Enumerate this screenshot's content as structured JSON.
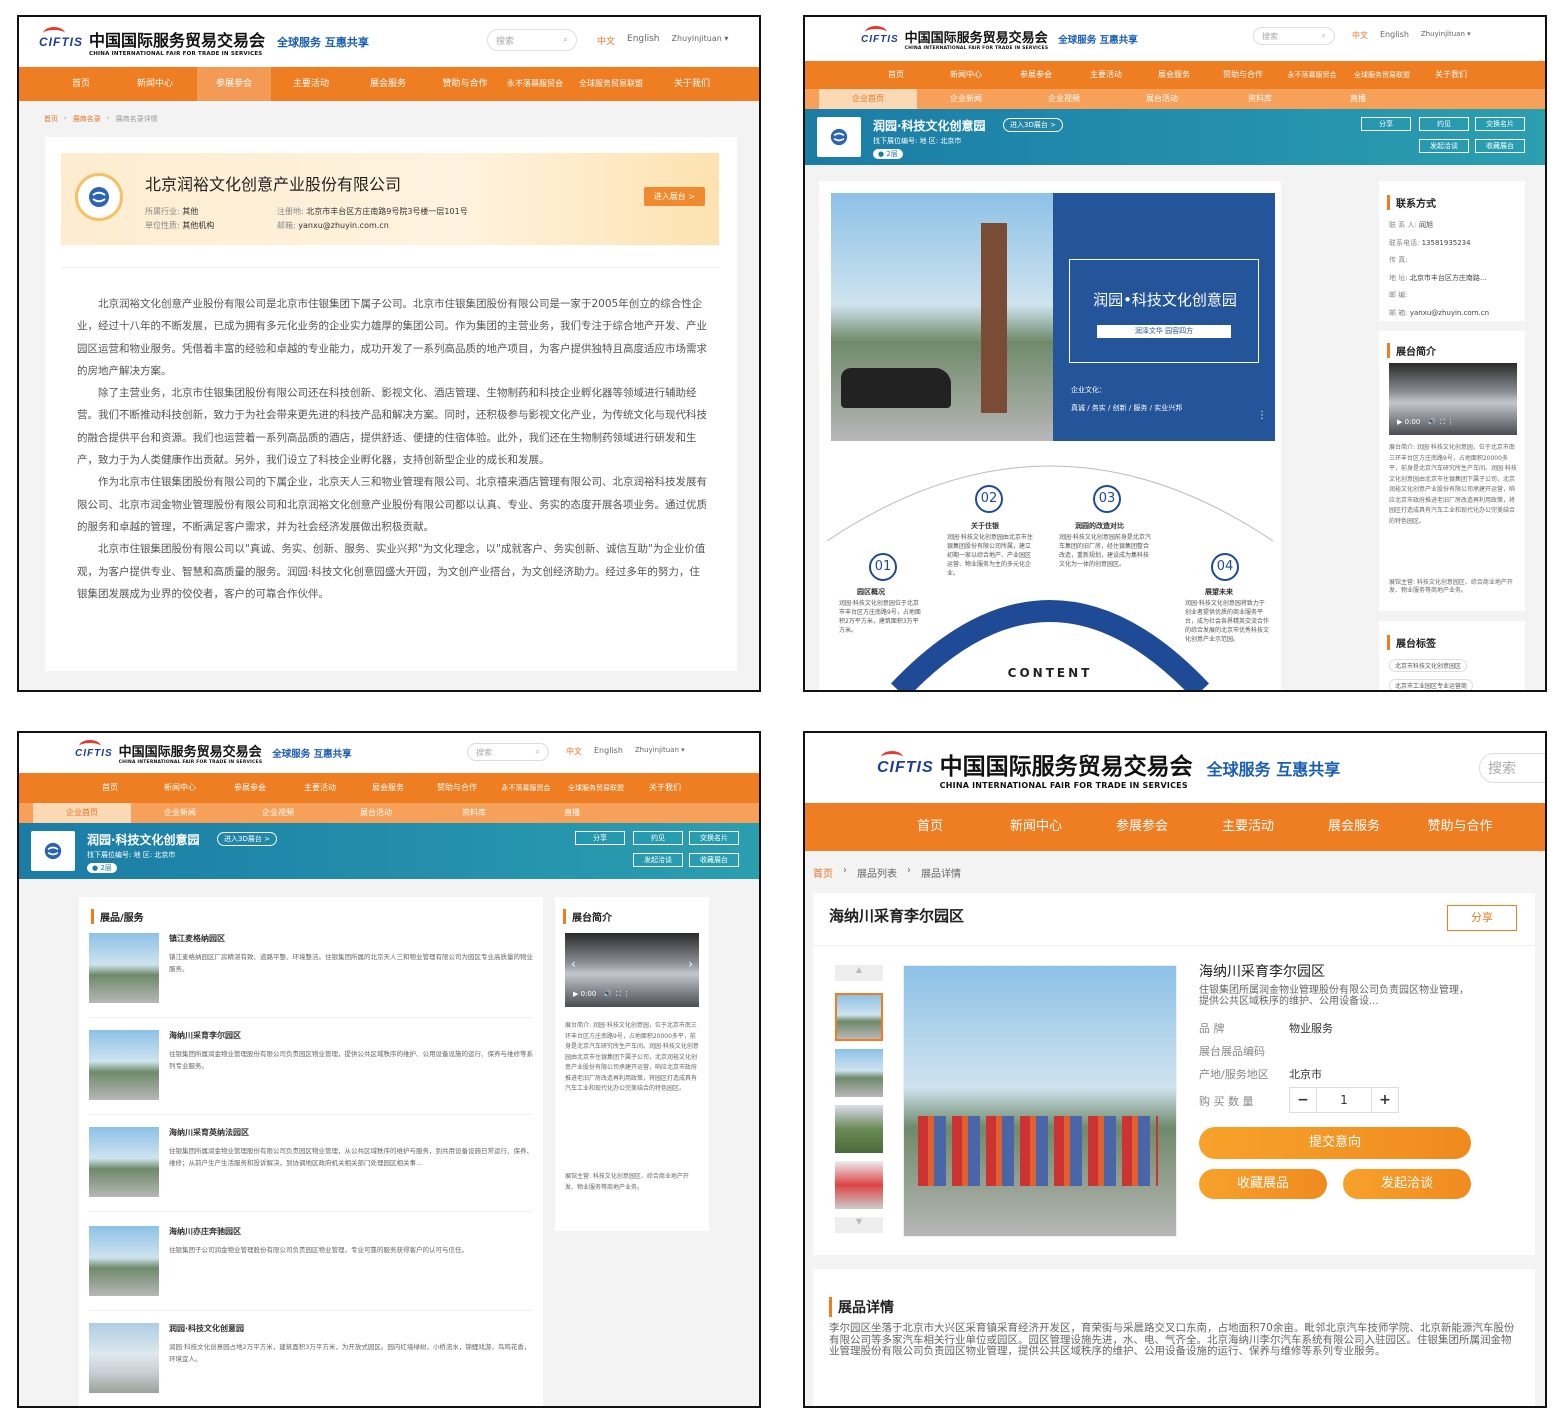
{
  "brand": {
    "mark": "CIFTIS",
    "cn": "中国国际服务贸易交易会",
    "en": "CHINA INTERNATIONAL FAIR FOR TRADE IN SERVICES",
    "slogan": "全球服务 互惠共享"
  },
  "header": {
    "search_placeholder": "搜索",
    "lang_cn": "中文",
    "lang_en": "English",
    "user": "Zhuyinjituan"
  },
  "nav": [
    "首页",
    "新闻中心",
    "参展参会",
    "主要活动",
    "展会服务",
    "赞助与合作",
    "永不落幕服贸会",
    "全球服务贸易联盟",
    "关于我们"
  ],
  "subnav": [
    "企业首页",
    "企业新闻",
    "企业视频",
    "展台活动",
    "资料库",
    "直播"
  ],
  "p1": {
    "breadcrumb": [
      "首页",
      "展商名录",
      "展商名录详情"
    ],
    "company": "北京润裕文化创意产业股份有限公司",
    "industry_label": "所属行业:",
    "industry": "其他",
    "nature_label": "单位性质:",
    "nature": "其他机构",
    "address_label": "注册地:",
    "address": "北京市丰台区方庄南路9号院3号楼一层101号",
    "email_label": "邮箱:",
    "email": "yanxu@zhuyin.com.cn",
    "enter_btn": "进入展台 >",
    "paragraphs": [
      "北京润裕文化创意产业股份有限公司是北京市住银集团下属子公司。北京市住银集团股份有限公司是一家于2005年创立的综合性企业，经过十八年的不断发展，已成为拥有多元化业务的企业实力雄厚的集团公司。作为集团的主营业务，我们专注于综合地产开发、产业园区运营和物业服务。凭借着丰富的经验和卓越的专业能力，成功开发了一系列高品质的地产项目，为客户提供独特且高度适应市场需求的房地产解决方案。",
      "除了主营业务，北京市住银集团股份有限公司还在科技创新、影视文化、酒店管理、生物制药和科技企业孵化器等领域进行辅助经营。我们不断推动科技创新，致力于为社会带来更先进的科技产品和解决方案。同时，还积极参与影视文化产业，为传统文化与现代科技的融合提供平台和资源。我们也运营着一系列高品质的酒店，提供舒适、便捷的住宿体验。此外，我们还在生物制药领域进行研发和生产，致力于为人类健康作出贡献。另外，我们设立了科技企业孵化器，支持创新型企业的成长和发展。",
      "作为北京市住银集团股份有限公司的下属企业，北京天人三和物业管理有限公司、北京禧来酒店管理有限公司、北京润裕科技发展有限公司、北京市润金物业管理股份有限公司和北京润裕文化创意产业股份有限公司都以认真、专业、务实的态度开展各项业务。通过优质的服务和卓越的管理，不断满足客户需求，并为社会经济发展做出积极贡献。",
      "北京市住银集团股份有限公司以\"真诚、务实、创新、服务、实业兴邦\"为文化理念，以\"成就客户、务实创新、诚信互助\"为企业价值观，为客户提供专业、智慧和高质量的服务。润园·科技文化创意园盛大开园，为文创产业搭台，为文创经济助力。经过多年的努力，住银集团发展成为业界的佼佼者，客户的可靠合作伙伴。"
    ]
  },
  "booth": {
    "name": "润园·科技文化创意园",
    "enter3d": "进入3D展台 >",
    "meta": "找下展位编号:      地      区: 北京市",
    "badge": "2层",
    "buttons": [
      "分享",
      "约见",
      "交换名片",
      "发起洽谈",
      "收藏展台"
    ]
  },
  "p2": {
    "poster_title": "润园•科技文化创意园",
    "poster_sub": "润泽文华   园容四方",
    "poster_culture": "企业文化：",
    "poster_values": "真诚 / 务实 / 创新 / 服务 / 实业兴邦",
    "content_word": "CONTENT",
    "items": [
      {
        "num": "01",
        "title": "园区概况",
        "text": "润园·科技文化创意园位于北京市丰台区方庄南路9号，占地面积2万平方米，建筑面积3万平方米。"
      },
      {
        "num": "02",
        "title": "关于住银",
        "text": "润园·科技文化创意园由北京市住银集团股份有限公司所属，建立初期一家以综合地产、产业园区运营、物业服务为主的多元化企业。"
      },
      {
        "num": "03",
        "title": "润园的改造对比",
        "text": "润园·科技文化创意园前身是北京汽车集团的旧厂房，经住银集团整合改造，重新规划，建设成为集科技文化为一体的创意园区。"
      },
      {
        "num": "04",
        "title": "展望未来",
        "text": "润园·科技文化创意园将致力于创业者提供优质的商业服务平台，成为社会各界精英交流合作的综合发展的北京市优秀科技文化创意产业示范园。"
      }
    ],
    "contact_title": "联系方式",
    "contact": [
      {
        "k": "联 系 人:",
        "v": "阎旭"
      },
      {
        "k": "联系电话:",
        "v": "13581935234"
      },
      {
        "k": "传    真:",
        "v": ""
      },
      {
        "k": "地    址:",
        "v": "北京市丰台区方庄南路..."
      },
      {
        "k": "邮    编:",
        "v": ""
      },
      {
        "k": "邮    箱:",
        "v": "yanxu@zhuyin.com.cn"
      }
    ],
    "intro_title": "展台简介",
    "video_time": "0:00",
    "intro_text": "展台简介: 润园·科技文化创意园，位于北京市南三环丰台区方庄南路9号，占地面积20000多平，前身是北京汽车研究所生产车间。润园·科技文化创意园由北京市住银集团下属子公司，北京润裕文化创意产业股份有限公司承建开运营，响应北京市政府推进老旧厂房改造再利用政策，将园区打造成具有汽车工业和现代化办公完美结合的特色园区。",
    "intro_scope": "展馆主营: 科技文化创意园区、综合商业地产开发、物业服务等商地产业务。",
    "tags_title": "展台标签",
    "tags": [
      "北京市科技文化创意园区",
      "北京市工业园区专业运营商"
    ]
  },
  "p3": {
    "products_title": "展品/服务",
    "products": [
      {
        "name": "镇江麦格纳园区",
        "desc": "镇江麦格纳园区厂房精湛有致、道路平整、环境整洁。住银集团所属的北京天人三和物业管理有限公司为园区专业高质量的物业服务。"
      },
      {
        "name": "海纳川采育李尔园区",
        "desc": "住银集团所属润金物业管理股份有限公司负责园区物业管理，提供公共区域秩序的维护、公用设备设施的运行、保养与维修等系列专业服务。"
      },
      {
        "name": "海纳川采育英纳法园区",
        "desc": "住银集团所属润金物业管理股份有限公司负责园区物业管理，从公共区域秩序的维护与服务，到共用设备设施日常运行、保养、维修；从前户生产生活服务和投诉解决，到协调地区政府机关相关部门处理园区相关事..."
      },
      {
        "name": "海纳川亦庄奔驰园区",
        "desc": "住银集团子公司润金物业管理股份有限公司负责园区物业管理，专业可靠的服务获得客户的认可与信任。"
      },
      {
        "name": "润园·科技文化创意园",
        "desc": "润园·科技文化创意园占地2万平方米，建筑面积3万平方米，为开放式园区。园内红墙绿树，小桥流水，锦鲤戏游，鸟鸣花香，环境宜人。"
      }
    ],
    "intro_title": "展台简介"
  },
  "p4": {
    "nav": [
      "首页",
      "新闻中心",
      "参展参会",
      "主要活动",
      "展会服务",
      "赞助与合作"
    ],
    "breadcrumb": [
      "首页",
      "展品列表",
      "展品详情"
    ],
    "title": "海纳川采育李尔园区",
    "share": "分享",
    "product_name": "海纳川采育李尔园区",
    "product_desc": "住银集团所属润金物业管理股份有限公司负责园区物业管理，提供公共区域秩序的维护、公用设备设...",
    "brand_label": "品     牌",
    "brand": "物业服务",
    "code_label": "展台展品编码",
    "code": "",
    "origin_label": "产地/服务地区",
    "origin": "北京市",
    "qty_label": "购 买 数 量",
    "qty": "1",
    "submit": "提交意向",
    "collect": "收藏展品",
    "talk": "发起洽谈",
    "detail_title": "展品详情",
    "detail": "李尔园区坐落于北京市大兴区采育镇采育经济开发区，育荣街与采晨路交叉口东南，占地面积70余亩。毗邻北京汽车技师学院、北京新能源汽车股份有限公司等多家汽车相关行业单位或园区。园区管理设施先进，水、电、气齐全。北京海纳川李尔汽车系统有限公司入驻园区。住银集团所属润金物业管理股份有限公司负责园区物业管理，提供公共区域秩序的维护、公用设备设施的运行、保养与维修等系列专业服务。"
  }
}
